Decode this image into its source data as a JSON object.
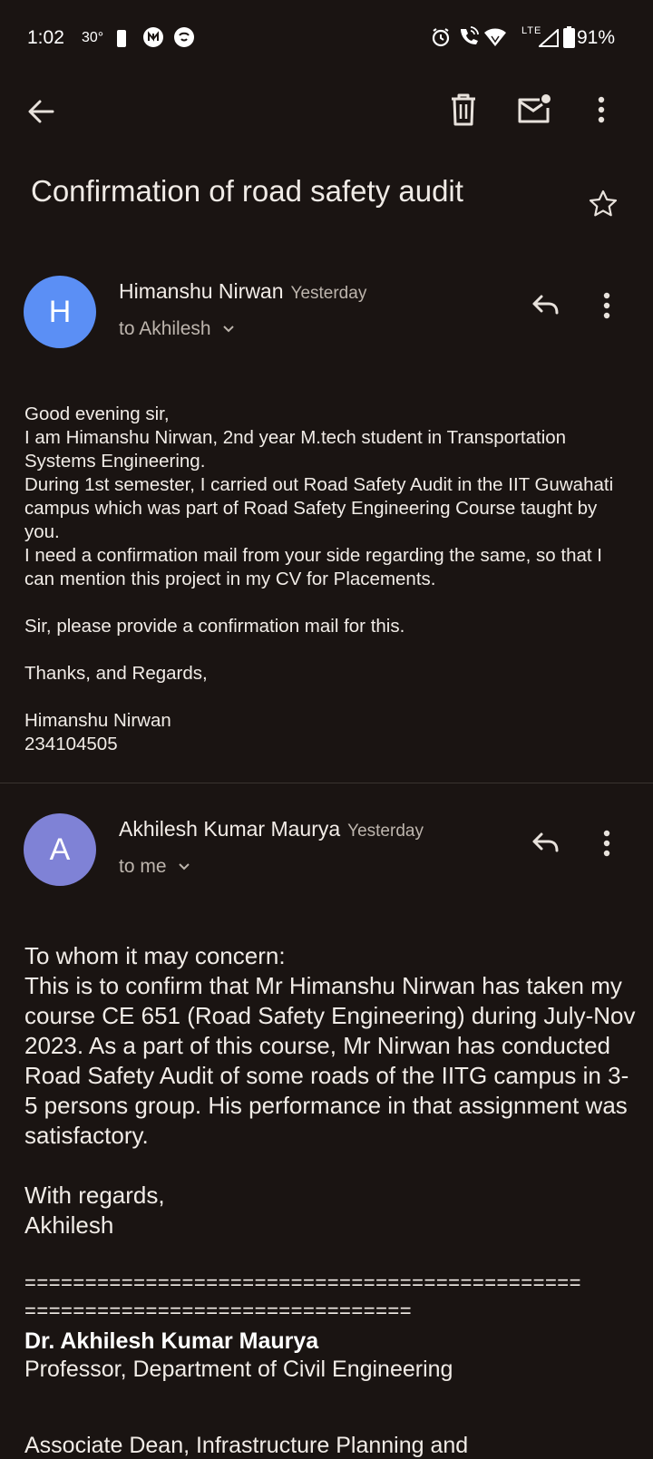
{
  "status_bar": {
    "time": "1:02",
    "temperature": "30°",
    "network": "LTE",
    "battery": "91%"
  },
  "toolbar": {
    "back_icon": "arrow-left-icon",
    "delete_icon": "trash-icon",
    "mark_unread_icon": "mail-unread-icon",
    "more_icon": "more-vert-icon"
  },
  "subject": "Confirmation of road safety audit",
  "messages": [
    {
      "avatar_letter": "H",
      "avatar_color": "#5b8ff5",
      "sender": "Himanshu Nirwan",
      "date": "Yesterday",
      "to": "to Akhilesh",
      "body": [
        "Good evening sir,",
        "I am Himanshu Nirwan, 2nd year M.tech student in Transportation Systems Engineering.",
        "During 1st semester, I carried out Road Safety Audit in the IIT Guwahati campus which was part of Road Safety Engineering Course taught by you.",
        "I need a confirmation mail from your side regarding the same, so that I can mention this project in my CV for Placements.",
        "",
        "Sir, please provide a confirmation mail for this.",
        "",
        "Thanks, and Regards,",
        "",
        "Himanshu Nirwan",
        "234104505"
      ]
    },
    {
      "avatar_letter": "A",
      "avatar_color": "#7f82d6",
      "sender": "Akhilesh Kumar Maurya",
      "date": "Yesterday",
      "to": "to me",
      "body": [
        "To whom it may concern:",
        "This is to confirm that Mr Himanshu Nirwan has taken my course CE 651 (Road Safety Engineering) during July-Nov 2023. As a part of this course, Mr Nirwan has conducted Road Safety Audit of some roads of the IITG campus in 3-5 persons group. His performance in that assignment was satisfactory.",
        "",
        "With regards,",
        "Akhilesh"
      ],
      "separator_line1": "==============================================",
      "separator_line2": "================================",
      "signature_name": "Dr. Akhilesh Kumar Maurya",
      "signature_title": "Professor,  Department of Civil Engineering",
      "signature_next": "Associate Dean, Infrastructure Planning and"
    }
  ]
}
